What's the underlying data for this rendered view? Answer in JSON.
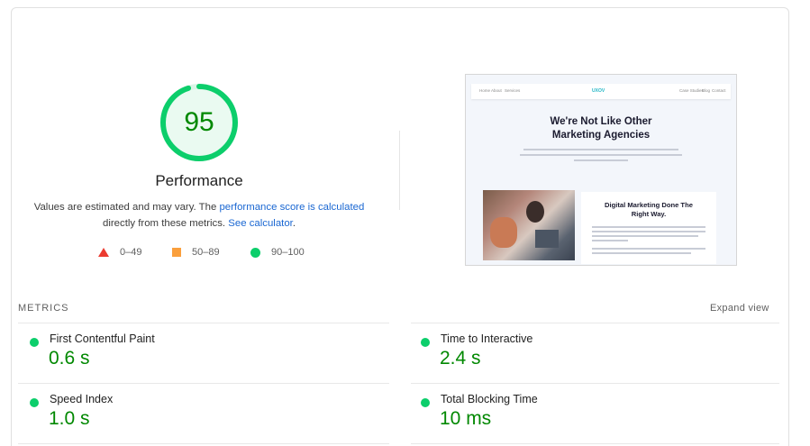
{
  "score": {
    "value": "95",
    "fraction": 0.95,
    "color": "#0cce6b",
    "track_color": "#d9f5e6"
  },
  "performance": {
    "title": "Performance",
    "desc_prefix": "Values are estimated and may vary. The ",
    "desc_link1": "performance score is calculated",
    "desc_middle": " directly from these metrics. ",
    "desc_link2": "See calculator",
    "desc_suffix": "."
  },
  "legend": [
    {
      "shape": "triangle",
      "label": "0–49",
      "color": "#eb3b30"
    },
    {
      "shape": "square",
      "label": "50–89",
      "color": "#fa9f3c"
    },
    {
      "shape": "circle",
      "label": "90–100",
      "color": "#0cce6b"
    }
  ],
  "screenshot": {
    "nav_left": [
      "Home",
      "About",
      "Services"
    ],
    "brand": "UXOV",
    "nav_right": [
      "Case Studies",
      "Blog",
      "Contact"
    ],
    "hero_title_line1": "We're Not Like Other",
    "hero_title_line2": "Marketing Agencies",
    "card_title_line1": "Digital Marketing Done The",
    "card_title_line2": "Right Way."
  },
  "metrics": {
    "label": "METRICS",
    "expand_label": "Expand view",
    "items": [
      {
        "name": "First Contentful Paint",
        "value": "0.6 s",
        "status": "good"
      },
      {
        "name": "Time to Interactive",
        "value": "2.4 s",
        "status": "good"
      },
      {
        "name": "Speed Index",
        "value": "1.0 s",
        "status": "good"
      },
      {
        "name": "Total Blocking Time",
        "value": "10 ms",
        "status": "good"
      }
    ]
  }
}
